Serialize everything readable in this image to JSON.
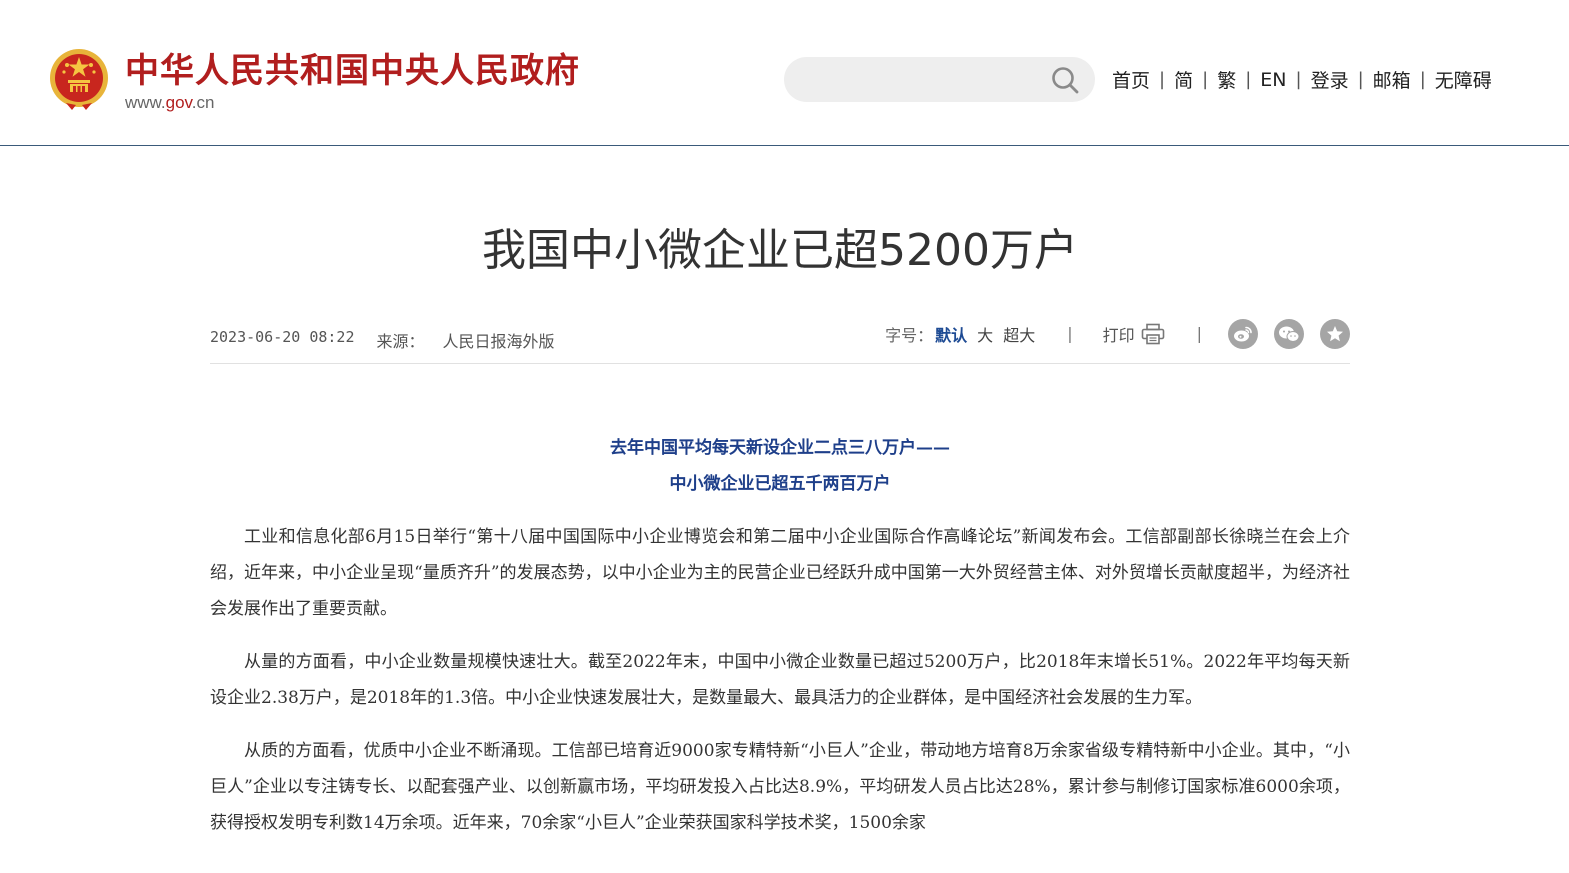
{
  "header": {
    "site_name": "中华人民共和国中央人民政府",
    "url_prefix": "www.",
    "url_domain": "gov",
    "url_suffix": ".cn",
    "search": {
      "value": "",
      "placeholder": ""
    },
    "nav": [
      {
        "label": "首页"
      },
      {
        "label": "简"
      },
      {
        "label": "繁"
      },
      {
        "label": "EN"
      },
      {
        "label": "登录"
      },
      {
        "label": "邮箱"
      },
      {
        "label": "无障碍"
      }
    ],
    "nav_separator": "|"
  },
  "article": {
    "title": "我国中小微企业已超5200万户",
    "date": "2023-06-20 08:22",
    "source_label": "来源：",
    "source": "人民日报海外版",
    "font_size_label": "字号：",
    "font_sizes": [
      "默认",
      "大",
      "超大"
    ],
    "separator": "|",
    "print_label": "打印",
    "subheads": [
      "去年中国平均每天新设企业二点三八万户——",
      "中小微企业已超五千两百万户"
    ],
    "paragraphs": [
      "工业和信息化部6月15日举行“第十八届中国国际中小企业博览会和第二届中小企业国际合作高峰论坛”新闻发布会。工信部副部长徐晓兰在会上介绍，近年来，中小企业呈现“量质齐升”的发展态势，以中小企业为主的民营企业已经跃升成中国第一大外贸经营主体、对外贸增长贡献度超半，为经济社会发展作出了重要贡献。",
      "从量的方面看，中小企业数量规模快速壮大。截至2022年末，中国中小微企业数量已超过5200万户，比2018年末增长51%。2022年平均每天新设企业2.38万户，是2018年的1.3倍。中小企业快速发展壮大，是数量最大、最具活力的企业群体，是中国经济社会发展的生力军。",
      "从质的方面看，优质中小企业不断涌现。工信部已培育近9000家专精特新“小巨人”企业，带动地方培育8万余家省级专精特新中小企业。其中，“小巨人”企业以专注铸专长、以配套强产业、以创新赢市场，平均研发投入占比达8.9%，平均研发人员占比达28%，累计参与制修订国家标准6000余项，获得授权发明专利数14万余项。近年来，70余家“小巨人”企业荣获国家科学技术奖，1500余家"
    ]
  },
  "colors": {
    "brand_red": "#b11e1e",
    "subhead_blue": "#1e3f8a",
    "active_blue": "#1e4b94",
    "header_border": "#3a5a7a",
    "share_gray": "#a5a5a5"
  },
  "icons": {
    "search": "search-icon",
    "print": "printer-icon",
    "share": [
      "weibo-icon",
      "wechat-icon",
      "favorite-star-icon"
    ]
  }
}
